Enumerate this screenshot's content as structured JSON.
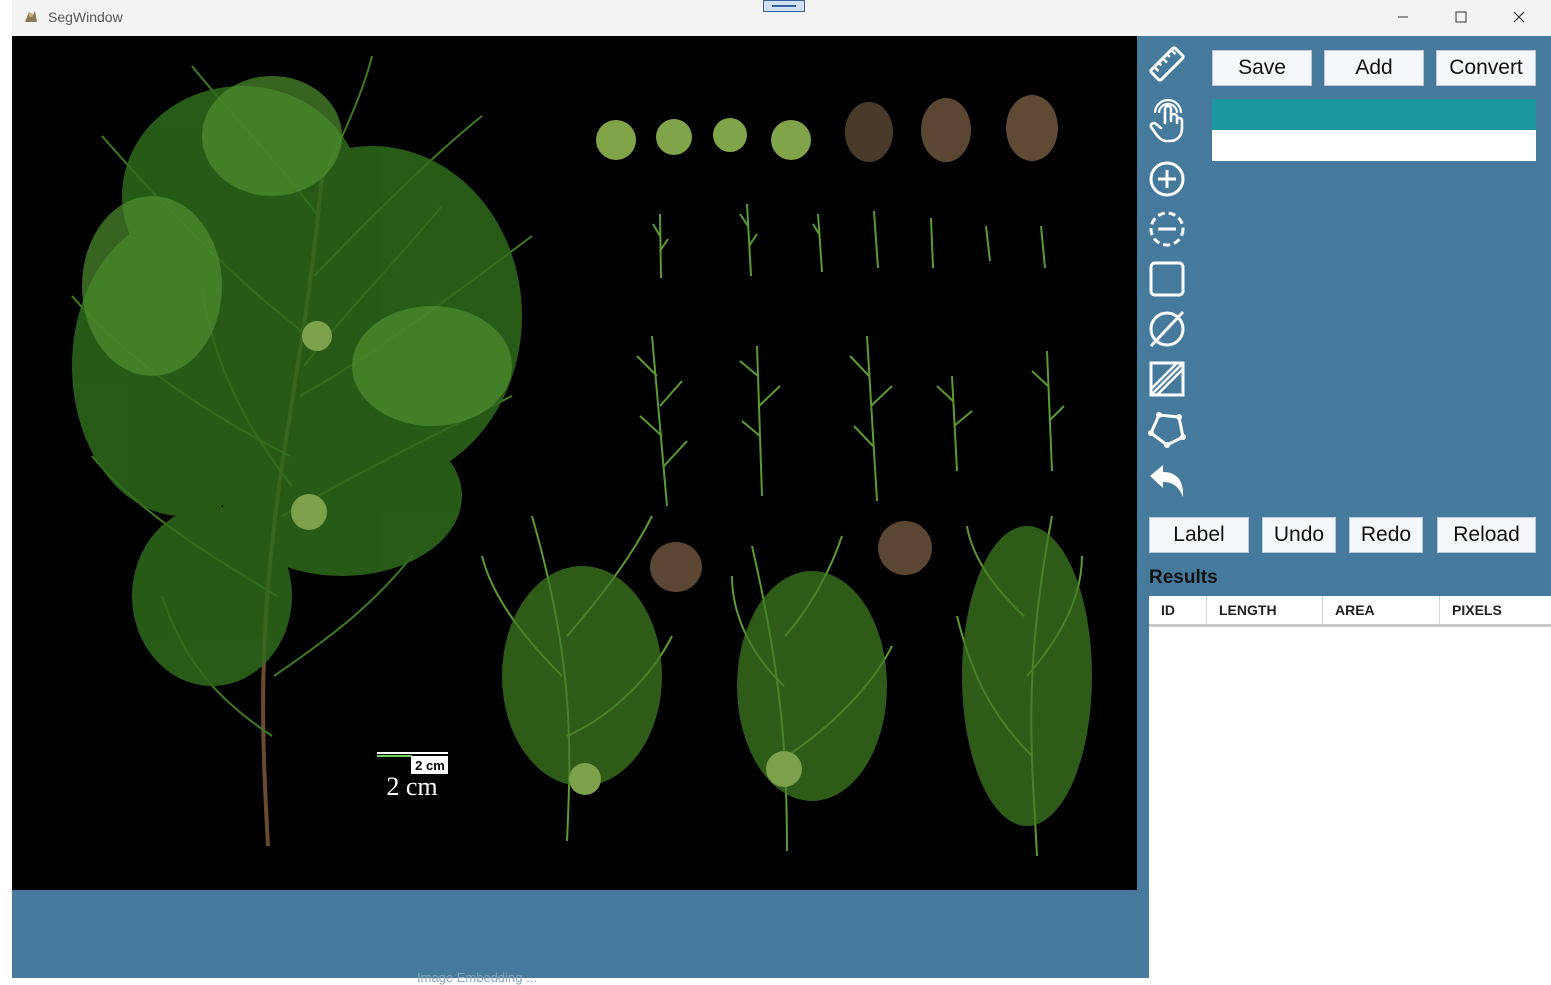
{
  "window": {
    "title": "SegWindow",
    "controls": [
      "minimize",
      "maximize",
      "close"
    ]
  },
  "canvas": {
    "scale_bar_small": "2 cm",
    "scale_bar_large": "2 cm"
  },
  "top_buttons": {
    "save": "Save",
    "add": "Add",
    "convert": "Convert"
  },
  "tools": [
    {
      "icon": "ruler-icon"
    },
    {
      "icon": "touch-hand-icon"
    },
    {
      "icon": "add-point-icon"
    },
    {
      "icon": "remove-point-icon"
    },
    {
      "icon": "box-select-icon"
    },
    {
      "icon": "clear-icon"
    },
    {
      "icon": "crop-icon"
    },
    {
      "icon": "polygon-icon"
    },
    {
      "icon": "undo-arrow-icon"
    }
  ],
  "labels": [
    {
      "color": "#1d979f",
      "text": ""
    },
    {
      "color": "#ffffff",
      "text": ""
    }
  ],
  "action_buttons": {
    "label": "Label",
    "undo": "Undo",
    "redo": "Redo",
    "reload": "Reload"
  },
  "results": {
    "title": "Results",
    "columns": [
      "ID",
      "LENGTH",
      "AREA",
      "PIXELS"
    ],
    "rows": []
  },
  "bottom_panel": {
    "status_text": "Image Embedding ..."
  },
  "colors": {
    "panel": "#467a9d",
    "label_teal": "#1d979f"
  }
}
